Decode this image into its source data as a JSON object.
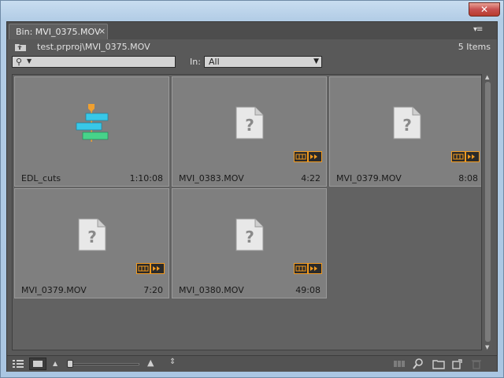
{
  "window": {
    "close_glyph": "✕"
  },
  "tab": {
    "title": "Bin: MVI_0375.MOV",
    "close_glyph": "×"
  },
  "panel_menu_glyph": "▾≡",
  "path": {
    "text": "test.prproj\\MVI_0375.MOV",
    "items_count": "5 Items"
  },
  "search": {
    "value": "",
    "icon": "magnifier-icon",
    "dropdown_glyph": "▼"
  },
  "filter": {
    "label": "In:",
    "selected": "All",
    "arrow": "▼"
  },
  "items": [
    {
      "name": "EDL_cuts",
      "duration": "1:10:08",
      "kind": "sequence"
    },
    {
      "name": "MVI_0383.MOV",
      "duration": "4:22",
      "kind": "media-offline"
    },
    {
      "name": "MVI_0379.MOV",
      "duration": "8:08",
      "kind": "media-offline"
    },
    {
      "name": "MVI_0379.MOV",
      "duration": "7:20",
      "kind": "media-offline"
    },
    {
      "name": "MVI_0380.MOV",
      "duration": "49:08",
      "kind": "media-offline"
    }
  ],
  "colors": {
    "badge_orange": "#f29a1e",
    "seq_cyan": "#38c8e8",
    "seq_green": "#47d38a",
    "seq_orange": "#f0a030"
  }
}
